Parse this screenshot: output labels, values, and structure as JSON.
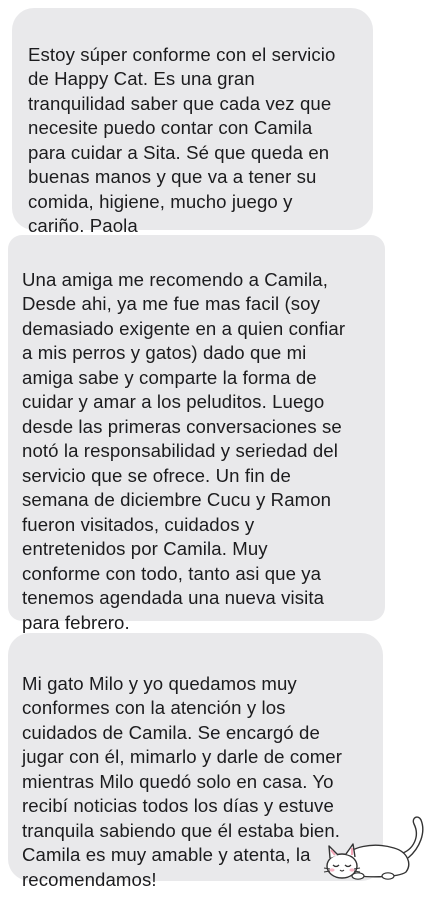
{
  "testimonials": [
    {
      "text": "Estoy súper conforme con el servicio\nde Happy Cat. Es una gran\ntranquilidad saber que cada vez que\nnecesite puedo contar con Camila\npara cuidar a Sita. Sé que queda en\nbuenas manos y que va a tener su\ncomida, higiene, mucho juego y\ncariño. Paola"
    },
    {
      "text": "Una amiga me recomendo a Camila,\nDesde ahi, ya me fue mas facil (soy\ndemasiado exigente en a quien confiar\na mis perros y gatos) dado que mi\namiga sabe y comparte la forma de\ncuidar y amar a los peluditos. Luego\ndesde las primeras conversaciones se\nnotó la responsabilidad y seriedad del\nservicio que se ofrece. Un fin de\nsemana de diciembre Cucu y Ramon\nfueron visitados, cuidados y\nentretenidos por Camila. Muy\nconforme con todo, tanto asi que ya\ntenemos agendada una nueva visita\npara febrero."
    },
    {
      "text": "Mi gato Milo y yo quedamos muy\nconformes con la atención y los\ncuidados de Camila. Se encargó de\njugar con él, mimarlo y darle de comer\nmientras Milo quedó solo en casa. Yo\nrecibí noticias todos los días y estuve\ntranquila sabiendo que él estaba bien.\nCamila es muy amable y atenta, la\nrecomendamos!"
    }
  ],
  "decoration": {
    "icon": "sleeping-cat-icon"
  }
}
